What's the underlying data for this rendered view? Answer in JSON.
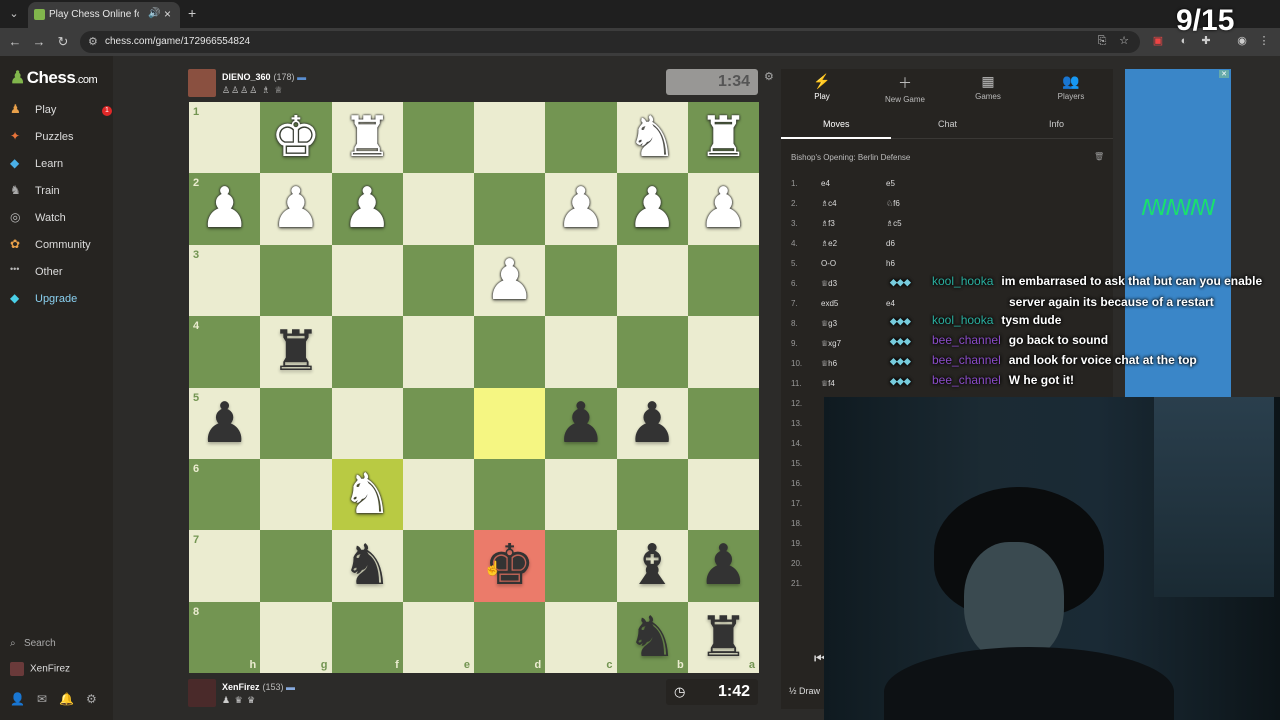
{
  "browser": {
    "tab_title": "Play Chess Online for FREE",
    "url": "chess.com/game/172966554824"
  },
  "sidebar": {
    "logo": "Chess",
    "logo_suffix": ".com",
    "items": [
      {
        "label": "Play",
        "icon": "♟",
        "badge": "1"
      },
      {
        "label": "Puzzles",
        "icon": "✦"
      },
      {
        "label": "Learn",
        "icon": "🎓"
      },
      {
        "label": "Train",
        "icon": "♞"
      },
      {
        "label": "Watch",
        "icon": "👁"
      },
      {
        "label": "Community",
        "icon": "✿"
      },
      {
        "label": "Other",
        "icon": "•••"
      },
      {
        "label": "Upgrade",
        "icon": "◆"
      }
    ],
    "search_label": "Search",
    "username": "XenFirez"
  },
  "top_player": {
    "name": "DIENO_360",
    "rating": "(178)",
    "captures": "♙♙♙♙ ♗ ♕",
    "clock": "1:34"
  },
  "bottom_player": {
    "name": "XenFirez",
    "rating": "(153)",
    "captures": "♟ ♛ ♛",
    "clock": "1:42"
  },
  "board": {
    "orientation": "black",
    "ranks": [
      "1",
      "2",
      "3",
      "4",
      "5",
      "6",
      "7",
      "8"
    ],
    "files": [
      "h",
      "g",
      "f",
      "e",
      "d",
      "c",
      "b",
      "a"
    ],
    "pieces": [
      {
        "square": "g1",
        "piece": "♚",
        "color": "w"
      },
      {
        "square": "f1",
        "piece": "♜",
        "color": "w"
      },
      {
        "square": "b1",
        "piece": "♞",
        "color": "w"
      },
      {
        "square": "a1",
        "piece": "♜",
        "color": "w"
      },
      {
        "square": "h2",
        "piece": "♟",
        "color": "w"
      },
      {
        "square": "g2",
        "piece": "♟",
        "color": "w"
      },
      {
        "square": "f2",
        "piece": "♟",
        "color": "w"
      },
      {
        "square": "c2",
        "piece": "♟",
        "color": "w"
      },
      {
        "square": "b2",
        "piece": "♟",
        "color": "w"
      },
      {
        "square": "a2",
        "piece": "♟",
        "color": "w"
      },
      {
        "square": "d3",
        "piece": "♟",
        "color": "w"
      },
      {
        "square": "g4",
        "piece": "♜",
        "color": "b"
      },
      {
        "square": "h5",
        "piece": "♟",
        "color": "b"
      },
      {
        "square": "c5",
        "piece": "♟",
        "color": "b"
      },
      {
        "square": "b5",
        "piece": "♟",
        "color": "b"
      },
      {
        "square": "f6",
        "piece": "♞",
        "color": "w"
      },
      {
        "square": "f7",
        "piece": "♞",
        "color": "b"
      },
      {
        "square": "d7",
        "piece": "♚",
        "color": "b"
      },
      {
        "square": "b7",
        "piece": "♝",
        "color": "b"
      },
      {
        "square": "a7",
        "piece": "♟",
        "color": "b"
      },
      {
        "square": "b8",
        "piece": "♞",
        "color": "b"
      },
      {
        "square": "a8",
        "piece": "♜",
        "color": "b"
      }
    ],
    "highlights": [
      {
        "square": "d5",
        "type": "y"
      },
      {
        "square": "f6",
        "type": "yd"
      },
      {
        "square": "d7",
        "type": "r"
      }
    ]
  },
  "panel": {
    "top_tabs": [
      {
        "label": "Play",
        "icon": "⚡"
      },
      {
        "label": "New Game",
        "icon": "＋"
      },
      {
        "label": "Games",
        "icon": "▦"
      },
      {
        "label": "Players",
        "icon": "👥"
      }
    ],
    "sub_tabs": [
      "Moves",
      "Chat",
      "Info"
    ],
    "opening": "Bishop's Opening: Berlin Defense",
    "moves": [
      {
        "n": "1.",
        "w": "e4",
        "b": "e5"
      },
      {
        "n": "2.",
        "w": "♗c4",
        "b": "♘f6"
      },
      {
        "n": "3.",
        "w": "♗f3",
        "b": "♗c5"
      },
      {
        "n": "4.",
        "w": "♗e2",
        "b": "d6"
      },
      {
        "n": "5.",
        "w": "O-O",
        "b": "h6"
      },
      {
        "n": "6.",
        "w": "♕d3",
        "b": ""
      },
      {
        "n": "7.",
        "w": "exd5",
        "b": "e4"
      },
      {
        "n": "8.",
        "w": "♕g3",
        "b": ""
      },
      {
        "n": "9.",
        "w": "♕xg7",
        "b": ""
      },
      {
        "n": "10.",
        "w": "♕h6",
        "b": ""
      },
      {
        "n": "11.",
        "w": "♕f4",
        "b": ""
      },
      {
        "n": "12.",
        "w": "",
        "b": ""
      },
      {
        "n": "13.",
        "w": "",
        "b": ""
      },
      {
        "n": "14.",
        "w": "",
        "b": ""
      },
      {
        "n": "15.",
        "w": "",
        "b": ""
      },
      {
        "n": "16.",
        "w": "",
        "b": ""
      },
      {
        "n": "17.",
        "w": "",
        "b": ""
      },
      {
        "n": "18.",
        "w": "",
        "b": ""
      },
      {
        "n": "19.",
        "w": "",
        "b": ""
      },
      {
        "n": "20.",
        "w": "",
        "b": ""
      },
      {
        "n": "21.",
        "w": "",
        "b": ""
      }
    ],
    "draw_label": "Draw"
  },
  "chat": [
    {
      "user": "kool_hooka",
      "color": "teal",
      "text": "im embarrased to ask that but can you enable"
    },
    {
      "user": "kool_hooka",
      "color": "teal",
      "text": "tysm dude"
    },
    {
      "user": "bee_channel",
      "color": "purple",
      "text": "go back to sound"
    },
    {
      "user": "bee_channel",
      "color": "purple",
      "text": "and look for voice chat at the top"
    },
    {
      "user": "bee_channel",
      "color": "purple",
      "text": "W he got it!"
    }
  ],
  "chat_continuation": "server again its because of a restart",
  "counter": "9/15"
}
